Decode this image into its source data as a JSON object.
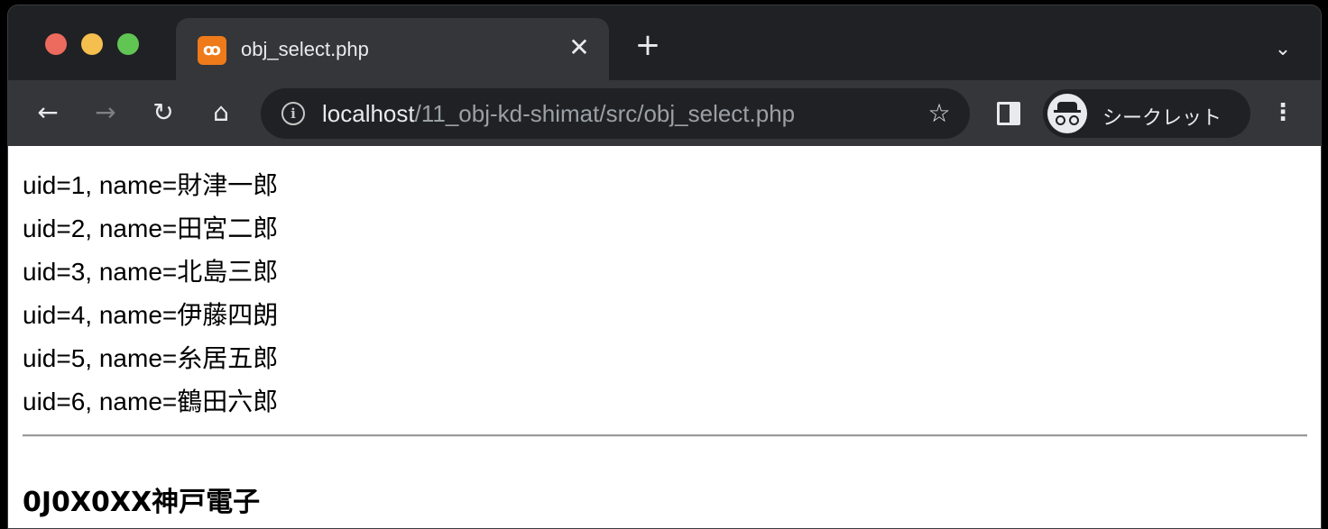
{
  "tab": {
    "title": "obj_select.php",
    "close": "✕",
    "favicon": "xampp-icon"
  },
  "tabstrip": {
    "new_tab": "+",
    "tab_search": "⌄"
  },
  "toolbar": {
    "back": "←",
    "forward": "→",
    "reload": "↻",
    "home": "⌂",
    "url_host": "localhost",
    "url_path": "/11_obj-kd-shimat/src/obj_select.php",
    "bookmark": "☆",
    "incognito_label": "シークレット",
    "menu": "⋮"
  },
  "page": {
    "rows": [
      "uid=1, name=財津一郎",
      "uid=2, name=田宮二郎",
      "uid=3, name=北島三郎",
      "uid=4, name=伊藤四朗",
      "uid=5, name=糸居五郎",
      "uid=6, name=鶴田六郎"
    ],
    "heading": "0J0X0XX神戸電子"
  },
  "colors": {
    "titlebar": "#202124",
    "toolbar": "#35363a",
    "favicon": "#ef7a1a",
    "traffic_red": "#ed6a5e",
    "traffic_yellow": "#f5bf4f",
    "traffic_green": "#61c554"
  }
}
